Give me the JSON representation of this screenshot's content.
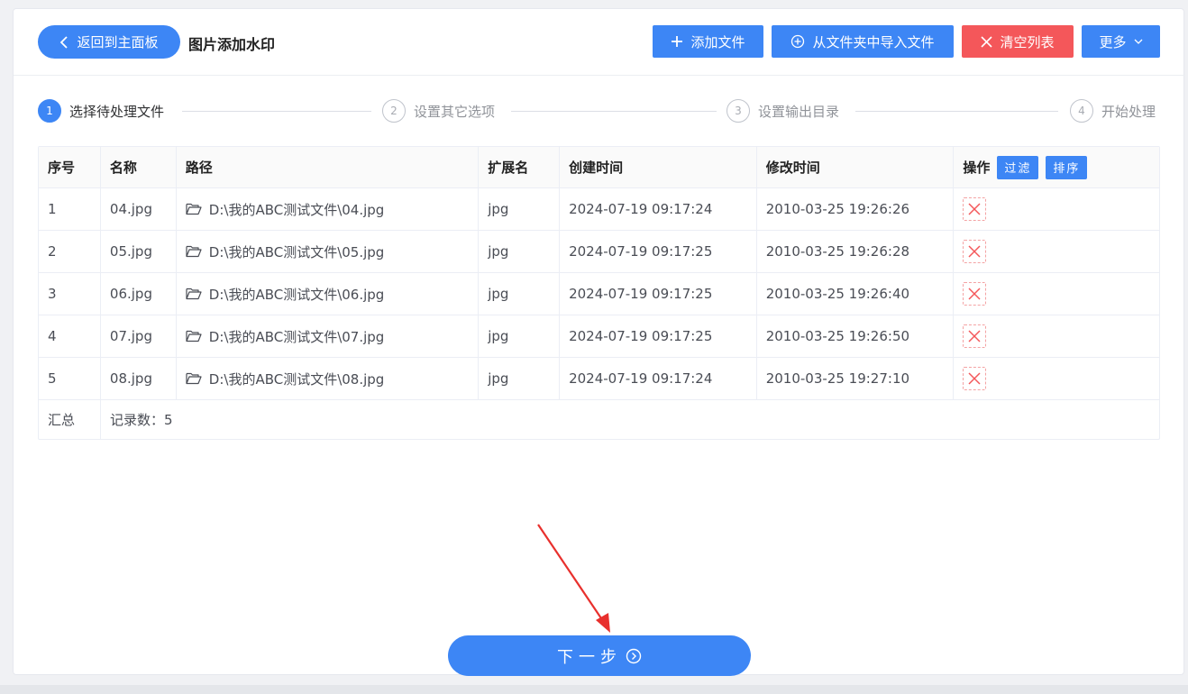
{
  "header": {
    "back_label": "返回到主面板",
    "title": "图片添加水印",
    "add_file_label": "添加文件",
    "import_folder_label": "从文件夹中导入文件",
    "clear_list_label": "清空列表",
    "more_label": "更多"
  },
  "steps": [
    {
      "num": "1",
      "label": "选择待处理文件"
    },
    {
      "num": "2",
      "label": "设置其它选项"
    },
    {
      "num": "3",
      "label": "设置输出目录"
    },
    {
      "num": "4",
      "label": "开始处理"
    }
  ],
  "table": {
    "headers": [
      "序号",
      "名称",
      "路径",
      "扩展名",
      "创建时间",
      "修改时间",
      "操作"
    ],
    "filter_label": "过滤",
    "sort_label": "排序",
    "rows": [
      {
        "index": "1",
        "name": "04.jpg",
        "path": "D:\\我的ABC测试文件\\04.jpg",
        "ext": "jpg",
        "created": "2024-07-19 09:17:24",
        "modified": "2010-03-25 19:26:26"
      },
      {
        "index": "2",
        "name": "05.jpg",
        "path": "D:\\我的ABC测试文件\\05.jpg",
        "ext": "jpg",
        "created": "2024-07-19 09:17:25",
        "modified": "2010-03-25 19:26:28"
      },
      {
        "index": "3",
        "name": "06.jpg",
        "path": "D:\\我的ABC测试文件\\06.jpg",
        "ext": "jpg",
        "created": "2024-07-19 09:17:25",
        "modified": "2010-03-25 19:26:40"
      },
      {
        "index": "4",
        "name": "07.jpg",
        "path": "D:\\我的ABC测试文件\\07.jpg",
        "ext": "jpg",
        "created": "2024-07-19 09:17:25",
        "modified": "2010-03-25 19:26:50"
      },
      {
        "index": "5",
        "name": "08.jpg",
        "path": "D:\\我的ABC测试文件\\08.jpg",
        "ext": "jpg",
        "created": "2024-07-19 09:17:24",
        "modified": "2010-03-25 19:27:10"
      }
    ],
    "summary_label": "汇总",
    "record_count_label": "记录数：5"
  },
  "next_label": "下一步",
  "colors": {
    "accent": "#3d86f5",
    "danger": "#f4575a"
  }
}
